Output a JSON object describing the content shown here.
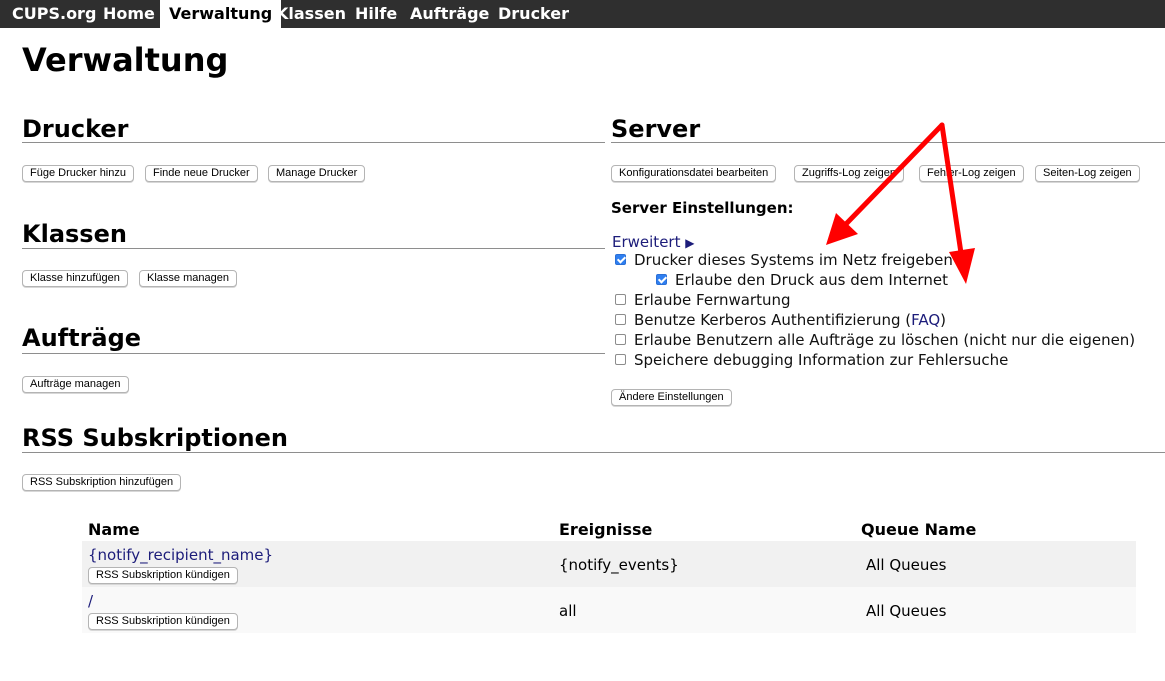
{
  "nav": {
    "items": [
      "CUPS.org",
      "Home",
      "Verwaltung",
      "Klassen",
      "Hilfe",
      "Aufträge",
      "Drucker"
    ],
    "active": "Verwaltung"
  },
  "page_title": "Verwaltung",
  "drucker": {
    "title": "Drucker",
    "buttons": [
      "Füge Drucker hinzu",
      "Finde neue Drucker",
      "Manage Drucker"
    ]
  },
  "klassen": {
    "title": "Klassen",
    "buttons": [
      "Klasse hinzufügen",
      "Klasse managen"
    ]
  },
  "auftraege": {
    "title": "Aufträge",
    "buttons": [
      "Aufträge managen"
    ]
  },
  "rss": {
    "title": "RSS Subskriptionen",
    "add_button": "RSS Subskription hinzufügen",
    "columns": [
      "Name",
      "Ereignisse",
      "Queue Name"
    ],
    "rows": [
      {
        "name": "{notify_recipient_name}",
        "cancel": "RSS Subskription kündigen",
        "events": "{notify_events}",
        "queue": "All Queues"
      },
      {
        "name": "/",
        "cancel": "RSS Subskription kündigen",
        "events": "all",
        "queue": "All Queues"
      }
    ]
  },
  "server": {
    "title": "Server",
    "buttons": [
      "Konfigurationsdatei bearbeiten",
      "Zugriffs-Log zeigen",
      "Fehler-Log zeigen",
      "Seiten-Log zeigen"
    ],
    "settings_title": "Server Einstellungen:",
    "advanced_link": "Erweitert",
    "advanced_arrow": "▶",
    "options": [
      {
        "label": "Drucker dieses Systems im Netz freigeben",
        "checked": true
      },
      {
        "label": "Erlaube den Druck aus dem Internet",
        "checked": true
      },
      {
        "label": "Erlaube Fernwartung",
        "checked": false
      },
      {
        "label_before": "Benutze Kerberos Authentifizierung (",
        "link": "FAQ",
        "label_after": ")",
        "checked": false
      },
      {
        "label": "Erlaube Benutzern alle Aufträge zu löschen (nicht nur die eigenen)",
        "checked": false
      },
      {
        "label": "Speichere debugging Information zur Fehlersuche",
        "checked": false
      }
    ],
    "apply_button": "Ändere Einstellungen"
  },
  "colors": {
    "nav_bg": "#2f2f2f",
    "link": "#1c1c7a",
    "checkbox_checked": "#2f7ff0",
    "row_bg": "#f1f1f1",
    "annotation_arrow": "#ff0000"
  },
  "annotation": {
    "type": "red-arrows",
    "count": 2
  }
}
